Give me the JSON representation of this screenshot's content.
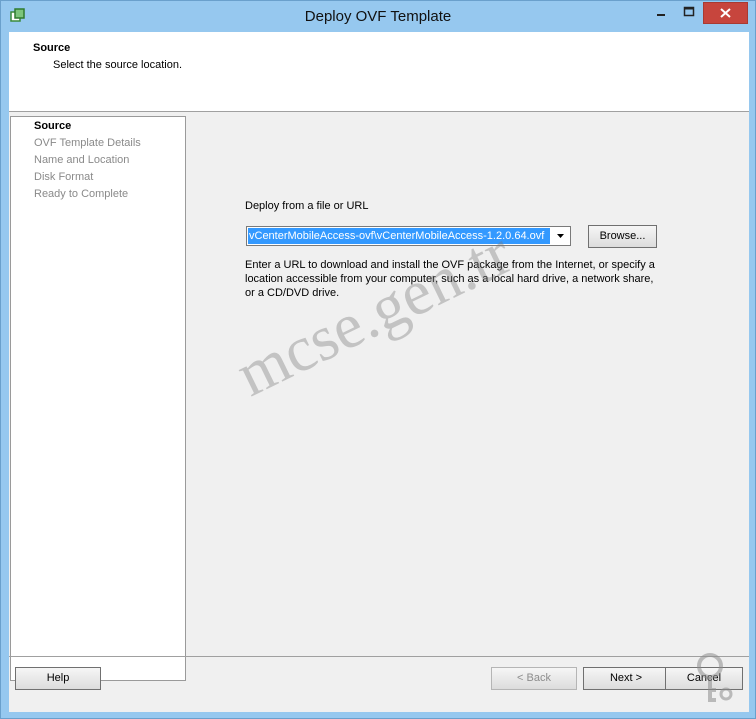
{
  "window": {
    "title": "Deploy OVF Template"
  },
  "header": {
    "title": "Source",
    "subtitle": "Select the source location."
  },
  "steps": [
    "Source",
    "OVF Template Details",
    "Name and Location",
    "Disk Format",
    "Ready to Complete"
  ],
  "source": {
    "label": "Deploy from a file or URL",
    "value": "vCenterMobileAccess-ovf\\vCenterMobileAccess-1.2.0.64.ovf",
    "browse_label": "Browse...",
    "help_text": "Enter a URL to download and install the OVF package from the Internet, or specify a location accessible from your computer, such as a local hard drive, a network share, or a CD/DVD drive."
  },
  "footer": {
    "help_label": "Help",
    "back_label": "< Back",
    "next_label": "Next >",
    "cancel_label": "Cancel"
  },
  "watermark": {
    "text": "mcse.gen.tr"
  },
  "colors": {
    "titlebar": "#96c8ef",
    "close": "#c7453d",
    "selection": "#3399ff"
  }
}
